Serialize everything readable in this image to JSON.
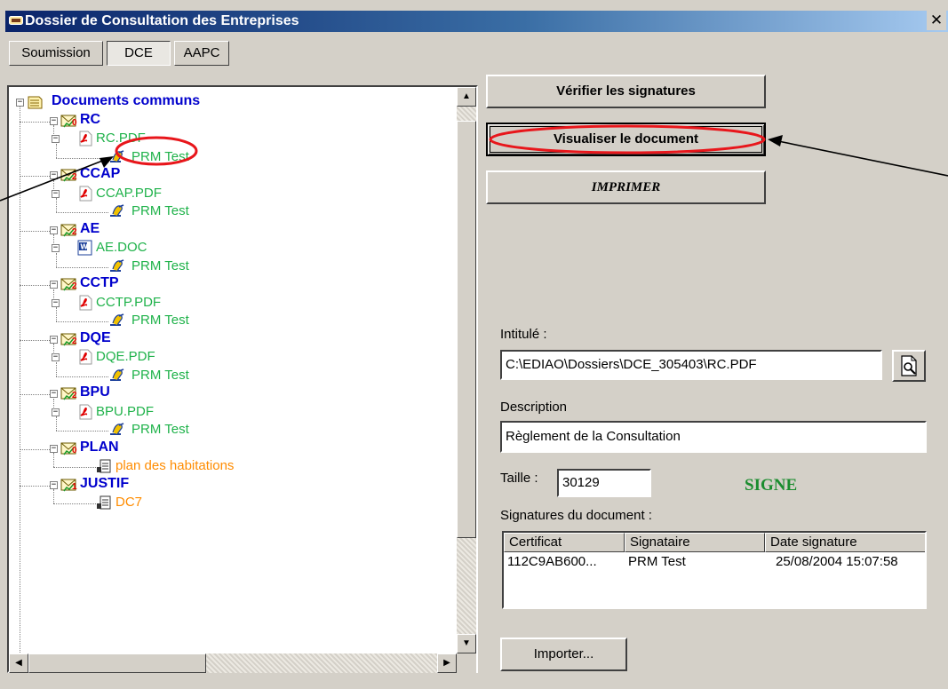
{
  "window": {
    "title": "Dossier de Consultation des Entreprises",
    "close_label": "✕"
  },
  "tabs": [
    {
      "label": "Soumission",
      "pressed": false
    },
    {
      "label": "DCE",
      "pressed": true
    },
    {
      "label": "AAPC",
      "pressed": false
    }
  ],
  "tree": {
    "root": "Documents communs",
    "groups": [
      {
        "label": "RC",
        "badge": "0",
        "file": "RC.PDF",
        "file_type": "pdf",
        "signer": "PRM Test"
      },
      {
        "label": "CCAP",
        "badge": "2",
        "file": "CCAP.PDF",
        "file_type": "pdf",
        "signer": "PRM Test"
      },
      {
        "label": "AE",
        "badge": "2",
        "file": "AE.DOC",
        "file_type": "doc",
        "signer": "PRM Test"
      },
      {
        "label": "CCTP",
        "badge": "2",
        "file": "CCTP.PDF",
        "file_type": "pdf",
        "signer": "PRM Test"
      },
      {
        "label": "DQE",
        "badge": "2",
        "file": "DQE.PDF",
        "file_type": "pdf",
        "signer": "PRM Test"
      },
      {
        "label": "BPU",
        "badge": "2",
        "file": "BPU.PDF",
        "file_type": "pdf",
        "signer": "PRM Test"
      },
      {
        "label": "PLAN",
        "badge": "0",
        "file": "plan des habitations",
        "file_type": "doc-orange"
      },
      {
        "label": "JUSTIF",
        "badge": "1",
        "file": "DC7",
        "file_type": "doc-orange"
      }
    ]
  },
  "actions": {
    "verify": "Vérifier les signatures",
    "view": "Visualiser le document",
    "print": "IMPRIMER",
    "import": "Importer..."
  },
  "details": {
    "intitule_label": "Intitulé :",
    "intitule_value": "C:\\EDIAO\\Dossiers\\DCE_305403\\RC.PDF",
    "description_label": "Description",
    "description_value": "Règlement de la Consultation",
    "taille_label": "Taille :",
    "taille_value": "30129",
    "status": "SIGNE",
    "signatures_label": "Signatures du document :"
  },
  "signatures_table": {
    "columns": [
      "Certificat",
      "Signataire",
      "Date signature"
    ],
    "rows": [
      [
        "112C9AB600...",
        "PRM Test",
        "25/08/2004 15:07:58"
      ]
    ]
  },
  "annotations": {
    "highlight_color": "#e8161b",
    "arrow_color": "#000000"
  }
}
